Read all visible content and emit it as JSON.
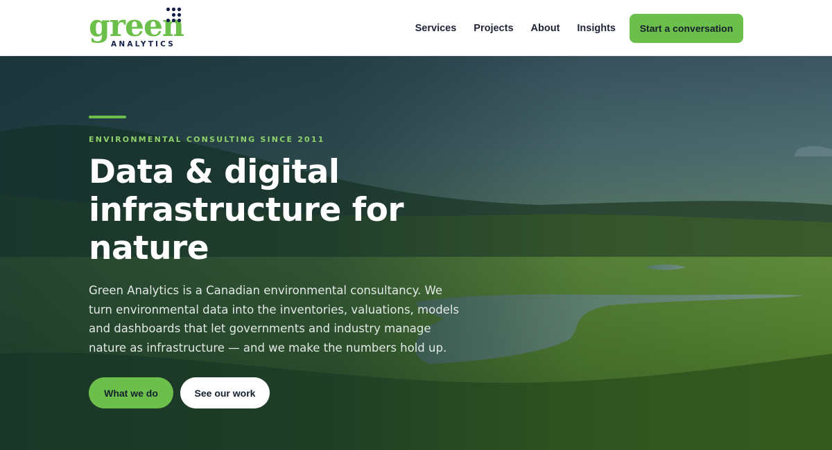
{
  "brand": {
    "wordmark": "green",
    "subline": "ANALYTICS",
    "primary_color": "#6cbf4b",
    "dots_color": "#15204a"
  },
  "nav": {
    "items": [
      {
        "label": "Services"
      },
      {
        "label": "Projects"
      },
      {
        "label": "About"
      },
      {
        "label": "Insights"
      }
    ],
    "cta_label": "Start a conversation"
  },
  "hero": {
    "eyebrow": "ENVIRONMENTAL CONSULTING SINCE 2011",
    "headline": "Data & digital infrastructure for nature",
    "lede": "Green Analytics is a Canadian environmental consultancy. We turn environmental data into the inventories, valuations, models and dashboards that let governments and industry manage nature as infrastructure — and we make the numbers hold up.",
    "primary_button": "What we do",
    "secondary_button": "See our work",
    "accent_color": "#6cbf4b"
  }
}
